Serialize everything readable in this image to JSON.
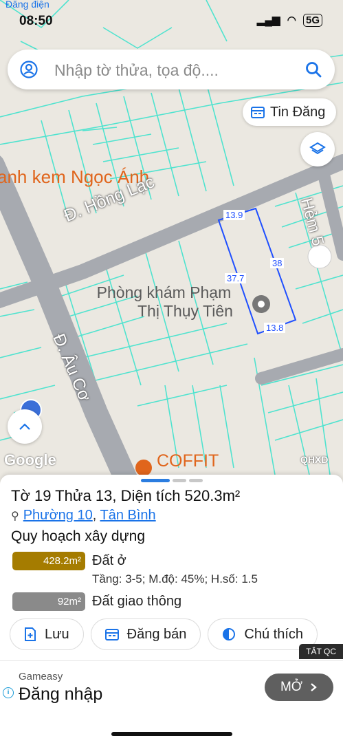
{
  "status_bar": {
    "time": "08:50",
    "network": "5G",
    "back_app": "Đăng điện"
  },
  "search": {
    "placeholder": "Nhập tờ thửa, tọa độ...."
  },
  "buttons": {
    "tin_dang": "Tin Đăng"
  },
  "map": {
    "labels": {
      "shop": "anh kem Ngọc Ánh",
      "street1": "Đ. Hồng Lạc",
      "street2": "Đ. Âu Cơ",
      "street3": "Hẻm 5",
      "clinic_line1": "Phòng khám Phạm",
      "clinic_line2": "Thị Thụy Tiên",
      "cafe": "COFFIT",
      "google": "Google",
      "qhxd": "QHXD"
    },
    "dimensions": {
      "top": "13.9",
      "right": "38",
      "left": "37.7",
      "bottom": "13.8"
    },
    "colors": {
      "road": "#a7aab0",
      "parcel_lines": "#4fe3cf",
      "highlight": "#1f4fff",
      "poi": "#e0651c"
    }
  },
  "parcel": {
    "title": "Tờ 19 Thửa 13, Diện tích 520.3m²",
    "ward": "Phường 10",
    "separator": ", ",
    "district": "Tân Bình"
  },
  "planning": {
    "heading": "Quy hoạch xây dựng",
    "items": [
      {
        "area": "428.2m²",
        "name": "Đất ở",
        "detail": "Tầng: 3-5; M.độ: 45%; H.số: 1.5",
        "color": "#a57c00"
      },
      {
        "area": "92m²",
        "name": "Đất giao thông",
        "color": "#8a8a8a"
      }
    ]
  },
  "actions": [
    {
      "label": "Lưu",
      "icon": "save-add-icon"
    },
    {
      "label": "Đăng bán",
      "icon": "listing-icon"
    },
    {
      "label": "Chú thích",
      "icon": "legend-icon"
    }
  ],
  "ad": {
    "close_label": "TẮT QC",
    "brand": "Gameasy",
    "headline": "Đăng nhập",
    "cta": "MỞ"
  }
}
